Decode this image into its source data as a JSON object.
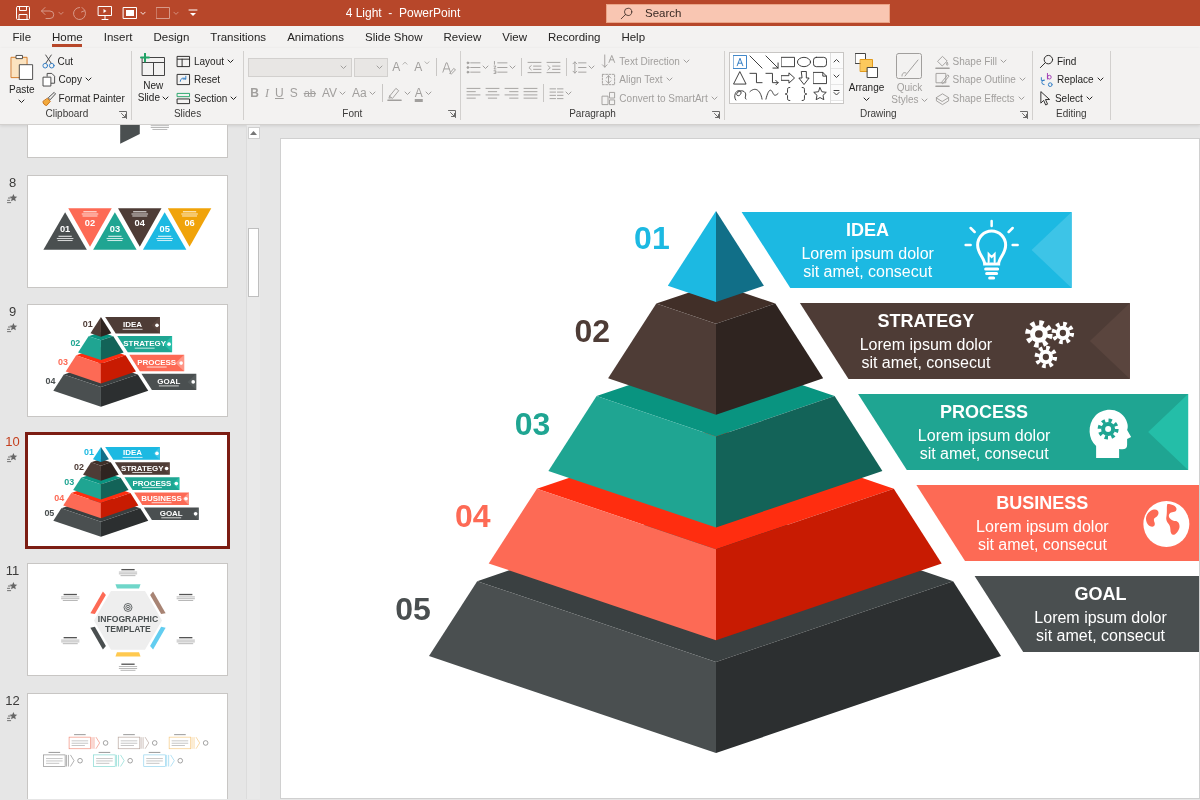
{
  "window": {
    "title": "4 Light  -  PowerPoint"
  },
  "quick_access": [
    {
      "disabled": false
    },
    {
      "disabled": true
    },
    {
      "disabled": true
    },
    {
      "disabled": false
    },
    {
      "disabled": false
    },
    {
      "disabled": true
    },
    {
      "disabled": false
    }
  ],
  "search": {
    "placeholder": "Search"
  },
  "tabs": [
    {
      "label": "File",
      "selected": false
    },
    {
      "label": "Home",
      "selected": true
    },
    {
      "label": "Insert",
      "selected": false
    },
    {
      "label": "Design",
      "selected": false
    },
    {
      "label": "Transitions",
      "selected": false
    },
    {
      "label": "Animations",
      "selected": false
    },
    {
      "label": "Slide Show",
      "selected": false
    },
    {
      "label": "Review",
      "selected": false
    },
    {
      "label": "View",
      "selected": false
    },
    {
      "label": "Recording",
      "selected": false
    },
    {
      "label": "Help",
      "selected": false
    }
  ],
  "ribbon": [
    {
      "kind": "clipboard",
      "label": "Clipboard",
      "launcher": true,
      "buttons": [
        {
          "label": "Paste",
          "caret": true,
          "disabled": false
        },
        {
          "label": "Cut",
          "caret": false,
          "disabled": false
        },
        {
          "label": "Copy",
          "caret": true,
          "disabled": false
        },
        {
          "label": "Format Painter",
          "caret": false,
          "disabled": false
        }
      ]
    },
    {
      "kind": "slides",
      "label": "Slides",
      "launcher": false,
      "buttons": [
        {
          "label": "New Slide",
          "caret": true,
          "disabled": false
        },
        {
          "label": "Layout",
          "caret": true,
          "disabled": false
        },
        {
          "label": "Reset",
          "caret": false,
          "disabled": false
        },
        {
          "label": "Section",
          "caret": true,
          "disabled": false
        }
      ]
    },
    {
      "kind": "font",
      "label": "Font",
      "launcher": true,
      "disabled": true,
      "buttons": [
        {
          "kind": "grow",
          "label": "A",
          "caret": false
        },
        {
          "kind": "shrink",
          "label": "A",
          "caret": false
        },
        {
          "kind": "bold",
          "label": "B",
          "caret": false
        },
        {
          "kind": "italic",
          "label": "I",
          "caret": false
        },
        {
          "kind": "underline",
          "label": "U",
          "caret": false
        },
        {
          "kind": "shadow",
          "label": "S",
          "caret": false
        },
        {
          "kind": "strike",
          "label": "ab",
          "caret": false
        },
        {
          "kind": "spacing",
          "label": "AV",
          "caret": true
        },
        {
          "kind": "case",
          "label": "Aa",
          "caret": true
        },
        {
          "kind": "color",
          "label": "A",
          "caret": true
        }
      ]
    },
    {
      "kind": "paragraph",
      "label": "Paragraph",
      "launcher": true,
      "disabled": true,
      "buttons": [
        {
          "label": "Text Direction",
          "caret": true
        },
        {
          "label": "Align Text",
          "caret": true
        },
        {
          "label": "Convert to SmartArt",
          "caret": true
        }
      ]
    },
    {
      "kind": "drawing",
      "label": "Drawing",
      "launcher": true,
      "buttons": [
        {
          "label": "Arrange",
          "caret": true,
          "disabled": false
        },
        {
          "label": "Quick Styles",
          "caret": true,
          "disabled": true
        },
        {
          "label": "Shape Fill",
          "caret": true,
          "disabled": true
        },
        {
          "label": "Shape Outline",
          "caret": true,
          "disabled": true
        },
        {
          "label": "Shape Effects",
          "caret": true,
          "disabled": true
        }
      ]
    },
    {
      "kind": "editing",
      "label": "Editing",
      "launcher": false,
      "buttons": [
        {
          "label": "Find",
          "caret": false,
          "disabled": false
        },
        {
          "label": "Replace",
          "caret": true,
          "disabled": false
        },
        {
          "label": "Select",
          "caret": true,
          "disabled": false
        }
      ]
    }
  ],
  "slides_panel": {
    "slides": [
      {
        "kind": "partial",
        "selected": false
      },
      {
        "kind": "triangles",
        "number": "8",
        "selected": false,
        "items": [
          {
            "number": "01",
            "color": "#4a4f50"
          },
          {
            "number": "02",
            "color": "#fd6a55"
          },
          {
            "number": "03",
            "color": "#1fa592"
          },
          {
            "number": "04",
            "color": "#4e3c36"
          },
          {
            "number": "05",
            "color": "#1cb9e2"
          },
          {
            "number": "06",
            "color": "#f0a30a"
          }
        ]
      },
      {
        "kind": "pyramid",
        "number": "9",
        "selected": false,
        "levels": [
          {
            "number": "01",
            "title": "IDEA",
            "color": "#4e3c36"
          },
          {
            "number": "02",
            "title": "STRATEGY",
            "color": "#1fa592"
          },
          {
            "number": "03",
            "title": "PROCESS",
            "color": "#fd6a55"
          },
          {
            "number": "04",
            "title": "GOAL",
            "color": "#4a4f50"
          }
        ]
      },
      {
        "kind": "pyramid",
        "number": "10",
        "selected": true,
        "levels": [
          {
            "number": "01",
            "title": "IDEA",
            "color": "#1cb9e2"
          },
          {
            "number": "02",
            "title": "STRATEGY",
            "color": "#4e3c36"
          },
          {
            "number": "03",
            "title": "PROCESS",
            "color": "#1fa592"
          },
          {
            "number": "04",
            "title": "BUSINESS",
            "color": "#fd6a55"
          },
          {
            "number": "05",
            "title": "GOAL",
            "color": "#4a4f50"
          }
        ]
      },
      {
        "kind": "hexagon",
        "number": "11",
        "selected": false,
        "title": "INFOGRAPHIC TEMPLATE",
        "segments": [
          {
            "color": "#6fd6c9"
          },
          {
            "color": "#a88474"
          },
          {
            "color": "#62cdf0"
          },
          {
            "color": "#ffc94f"
          },
          {
            "color": "#4a4f50"
          },
          {
            "color": "#fd6a55"
          }
        ]
      },
      {
        "kind": "process",
        "number": "12",
        "selected": false
      }
    ]
  },
  "slide": {
    "levels": [
      {
        "number": "01",
        "title": "IDEA",
        "body": "Lorem ipsum dolor sit amet, consecut",
        "color": "#1cb9e2"
      },
      {
        "number": "02",
        "title": "STRATEGY",
        "body": "Lorem ipsum dolor sit amet, consecut",
        "color": "#4e3c36"
      },
      {
        "number": "03",
        "title": "PROCESS",
        "body": "Lorem ipsum dolor sit amet, consecut",
        "color": "#1fa592"
      },
      {
        "number": "04",
        "title": "BUSINESS",
        "body": "Lorem ipsum dolor sit amet, consecut",
        "color": "#fd6a55"
      },
      {
        "number": "05",
        "title": "GOAL",
        "body": "Lorem ipsum dolor sit amet, consecut",
        "color": "#4a4f50"
      }
    ]
  }
}
